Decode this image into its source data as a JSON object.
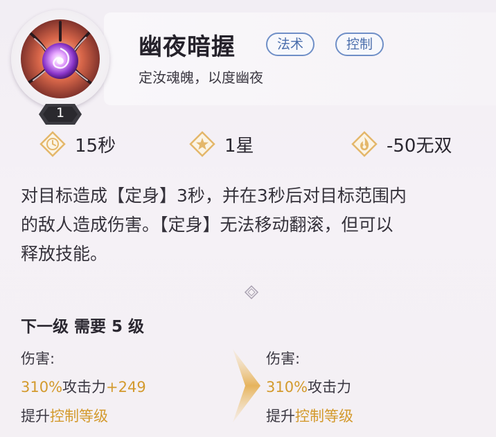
{
  "skill": {
    "name": "幽夜暗握",
    "subtitle": "定汝魂魄，以度幽夜",
    "tags": [
      "法术",
      "控制"
    ],
    "level": "1"
  },
  "stats": {
    "cooldown": "15秒",
    "star": "1星",
    "cost": "-50无双"
  },
  "description": {
    "lines": [
      "对目标造成【定身】3秒，并在3秒后对目标范围内",
      "的敌人造成伤害。【定身】无法移动翻滚，但可以",
      "释放技能。"
    ]
  },
  "upgrade": {
    "header": "下一级 需要 5 级",
    "current": {
      "label": "伤害:",
      "value_percent": "310%",
      "value_mid": "攻击力",
      "value_bonus": "+249",
      "upgrade_prefix": "提升",
      "upgrade_highlight": "控制等级"
    },
    "next": {
      "label": "伤害:",
      "value_percent": "310%",
      "value_mid": "攻击力",
      "upgrade_prefix": "提升",
      "upgrade_highlight": "控制等级"
    }
  },
  "icons": {
    "skill": "shadow-vortex-icon",
    "cooldown": "clock-icon",
    "star": "star-icon",
    "cost": "flame-icon",
    "divider": "diamond-icon",
    "arrow": "chevron-right-icon"
  },
  "colors": {
    "accent_gold": "#d39a2d",
    "tag_blue": "#4a6eac",
    "icon_gold": "#e4b76a"
  }
}
